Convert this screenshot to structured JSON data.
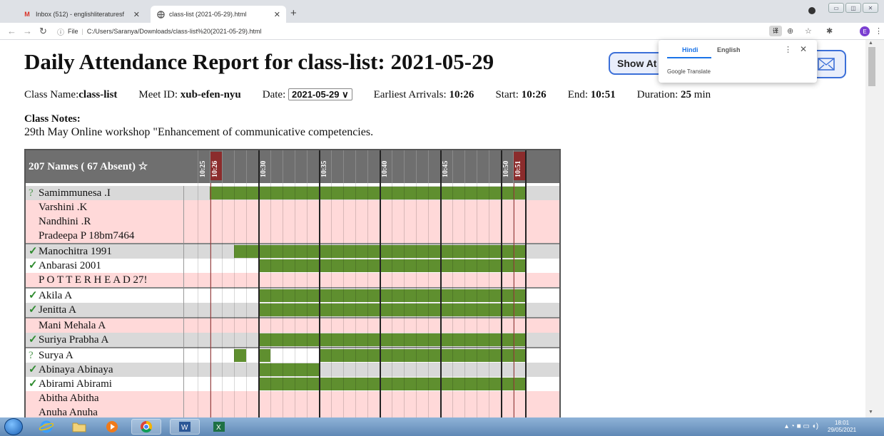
{
  "browser": {
    "tabs": [
      {
        "label": "Inbox (512) - englishliteraturesf",
        "icon": "gmail-icon"
      },
      {
        "label": "class-list (2021-05-29).html",
        "icon": "globe-icon"
      }
    ],
    "new_tab": "+",
    "address": {
      "prefix": "File",
      "url": "C:/Users/Saranya/Downloads/class-list%20(2021-05-29).html"
    },
    "avatar_letter": "E"
  },
  "report": {
    "title": "Daily Attendance Report for class-list: 2021-05-29",
    "show_button": "Show At",
    "info": {
      "class_name_label": "Class Name:",
      "class_name": "class-list",
      "meet_label": "Meet ID: ",
      "meet_id": "xub-efen-nyu",
      "date_label": "Date: ",
      "date_value": "2021-05-29 ∨",
      "earliest_label": "Earliest Arrivals: ",
      "earliest": "10:26",
      "start_label": "Start: ",
      "start": "10:26",
      "end_label": "End: ",
      "end": "10:51",
      "duration_label": "Duration: ",
      "duration": "25",
      "duration_unit": " min"
    },
    "notes_heading": "Class Notes:",
    "notes_text": "29th May Online workshop \"Enhancement of communicative competencies."
  },
  "table": {
    "names_header": "207 Names ( 67 Absent) ☆",
    "time_labels": [
      "10:25",
      "10:26",
      "10:30",
      "10:35",
      "10:40",
      "10:45",
      "10:50",
      "10:51"
    ],
    "rows": [
      {
        "mark": "?",
        "name": "Samimmunesa .I",
        "band": "grey",
        "present_from": 1,
        "present_to": 27
      },
      {
        "mark": "",
        "name": "Varshini .K",
        "band": "pink"
      },
      {
        "mark": "",
        "name": "Nandhini .R",
        "band": "pink"
      },
      {
        "mark": "",
        "name": "Pradeepa P 18bm7464",
        "band": "pink"
      },
      {
        "mark": "✓",
        "name": "Manochitra 1991",
        "band": "grey",
        "present_from": 3,
        "present_to": 27
      },
      {
        "mark": "✓",
        "name": "Anbarasi 2001",
        "band": "white",
        "present_from": 5,
        "present_to": 27
      },
      {
        "mark": "",
        "name": "P O T T E R H E A D 27!",
        "band": "pink"
      },
      {
        "mark": "✓",
        "name": "Akila A",
        "band": "white",
        "present_from": 5,
        "present_to": 27
      },
      {
        "mark": "✓",
        "name": "Jenitta A",
        "band": "grey",
        "present_from": 5,
        "present_to": 27
      },
      {
        "mark": "",
        "name": "Mani Mehala A",
        "band": "pink"
      },
      {
        "mark": "✓",
        "name": "Suriya Prabha A",
        "band": "grey",
        "present_from": 5,
        "present_to": 27
      },
      {
        "mark": "?",
        "name": "Surya A",
        "band": "white",
        "segments": [
          [
            3,
            4
          ],
          [
            5,
            6
          ],
          [
            10,
            27
          ]
        ]
      },
      {
        "mark": "✓",
        "name": "Abinaya Abinaya",
        "band": "grey",
        "present_from": 5,
        "present_to": 10
      },
      {
        "mark": "✓",
        "name": "Abirami Abirami",
        "band": "white",
        "present_from": 5,
        "present_to": 27
      },
      {
        "mark": "",
        "name": "Abitha Abitha",
        "band": "pink"
      },
      {
        "mark": "",
        "name": "Anuha Anuha",
        "band": "pink"
      }
    ]
  },
  "translate": {
    "lang_a": "Hindi",
    "lang_b": "English",
    "menu": "⋮",
    "close": "✕",
    "label": "Google Translate"
  },
  "taskbar": {
    "clock_time": "18:01",
    "clock_date": "29/05/2021"
  },
  "colors": {
    "present": "#5f8f2f",
    "absent_band": "#ffd9d9",
    "grey_band": "#d9d9d9",
    "header": "#6f6f6f"
  }
}
